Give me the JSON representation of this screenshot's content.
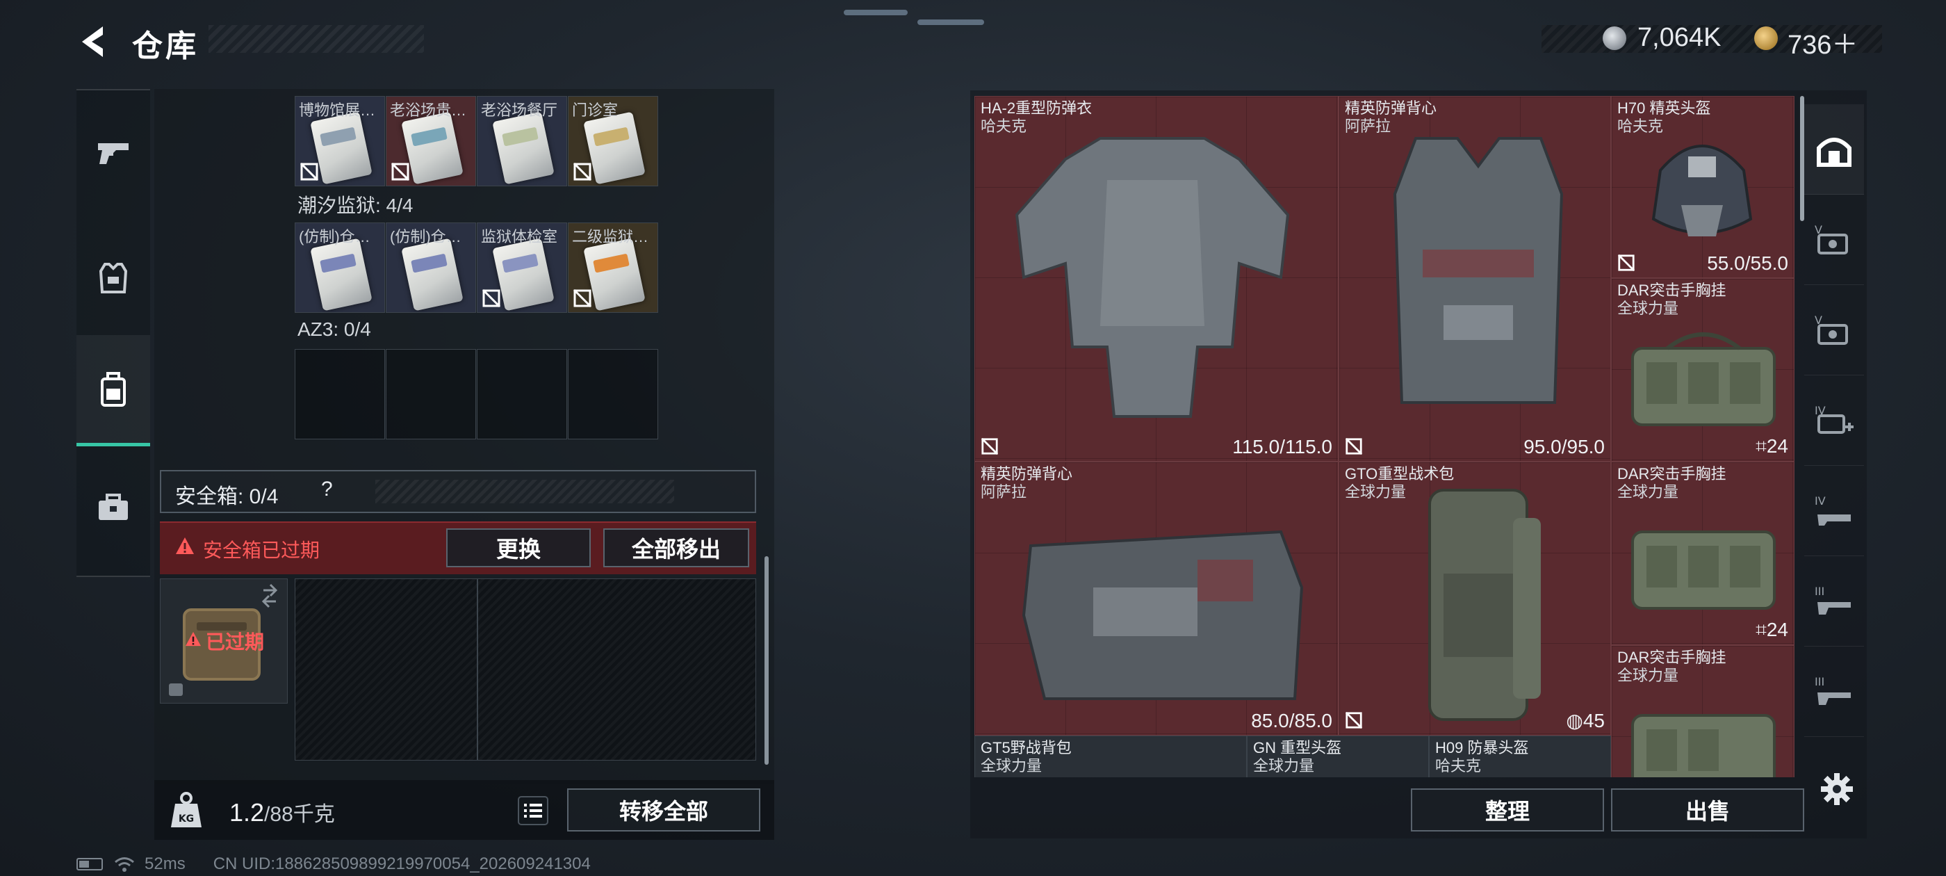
{
  "header": {
    "title": "仓库",
    "currency": {
      "coins": "7,064K",
      "gems": "736＋"
    }
  },
  "left_tabs": [
    {
      "name": "weapons",
      "icon": "pistol-icon",
      "active": false
    },
    {
      "name": "armor",
      "icon": "vest-icon",
      "active": false
    },
    {
      "name": "backpack",
      "icon": "backpack-icon",
      "active": true
    },
    {
      "name": "tools",
      "icon": "toolbox-icon",
      "active": false
    }
  ],
  "container": {
    "top_row_labels": [
      "博物馆展…",
      "老浴场贵…",
      "老浴场餐厅",
      "门诊室"
    ],
    "section1_label": "潮汐监狱: 4/4",
    "section1_row_labels": [
      "(仿制)仓…",
      "(仿制)仓…",
      "监狱体检室",
      "二级监狱…"
    ],
    "section2_label": "AZ3: 0/4"
  },
  "safebox": {
    "label": "安全箱: 0/4",
    "help": "?",
    "expired_text": "安全箱已过期",
    "replace_label": "更换",
    "move_all_label": "全部移出",
    "case_expired_label": "已过期"
  },
  "weight": {
    "current": "1.2",
    "max": "/88千克",
    "transfer_label": "转移全部"
  },
  "inventory": {
    "items": [
      {
        "name": "HA-2重型防弹衣",
        "brand": "哈夫克",
        "value": "115.0/115.0"
      },
      {
        "name": "精英防弹背心",
        "brand": "阿萨拉",
        "value": "95.0/95.0"
      },
      {
        "name": "H70 精英头盔",
        "brand": "哈夫克",
        "value": "55.0/55.0"
      },
      {
        "name": "DAR突击手胸挂",
        "brand": "全球力量",
        "value": "24"
      },
      {
        "name": "精英防弹背心",
        "brand": "阿萨拉",
        "value": "85.0/85.0"
      },
      {
        "name": "GTO重型战术包",
        "brand": "全球力量",
        "value": "45"
      },
      {
        "name": "DAR突击手胸挂",
        "brand": "全球力量",
        "value": "24"
      },
      {
        "name": "DAR突击手胸挂",
        "brand": "全球力量",
        "value": ""
      },
      {
        "name": "GT5野战背包",
        "brand": "全球力量",
        "value": ""
      },
      {
        "name": "GN 重型头盔",
        "brand": "全球力量",
        "value": ""
      },
      {
        "name": "H09 防暴头盔",
        "brand": "哈夫克",
        "value": ""
      }
    ],
    "organize_label": "整理",
    "sell_label": "出售"
  },
  "right_tabs": [
    "home-icon",
    "tier-v-icon",
    "tier-v-icon",
    "tier-iv-icon",
    "tier-iv-icon",
    "tier-iii-icon",
    "tier-iii-icon"
  ],
  "status": {
    "ping": "52ms",
    "uid": "CN UID:18862850989921997005​4_202609241304"
  },
  "colors": {
    "accent": "#37c6a6",
    "warning": "#ff5a5a",
    "item_red": "#5a2a2f"
  }
}
